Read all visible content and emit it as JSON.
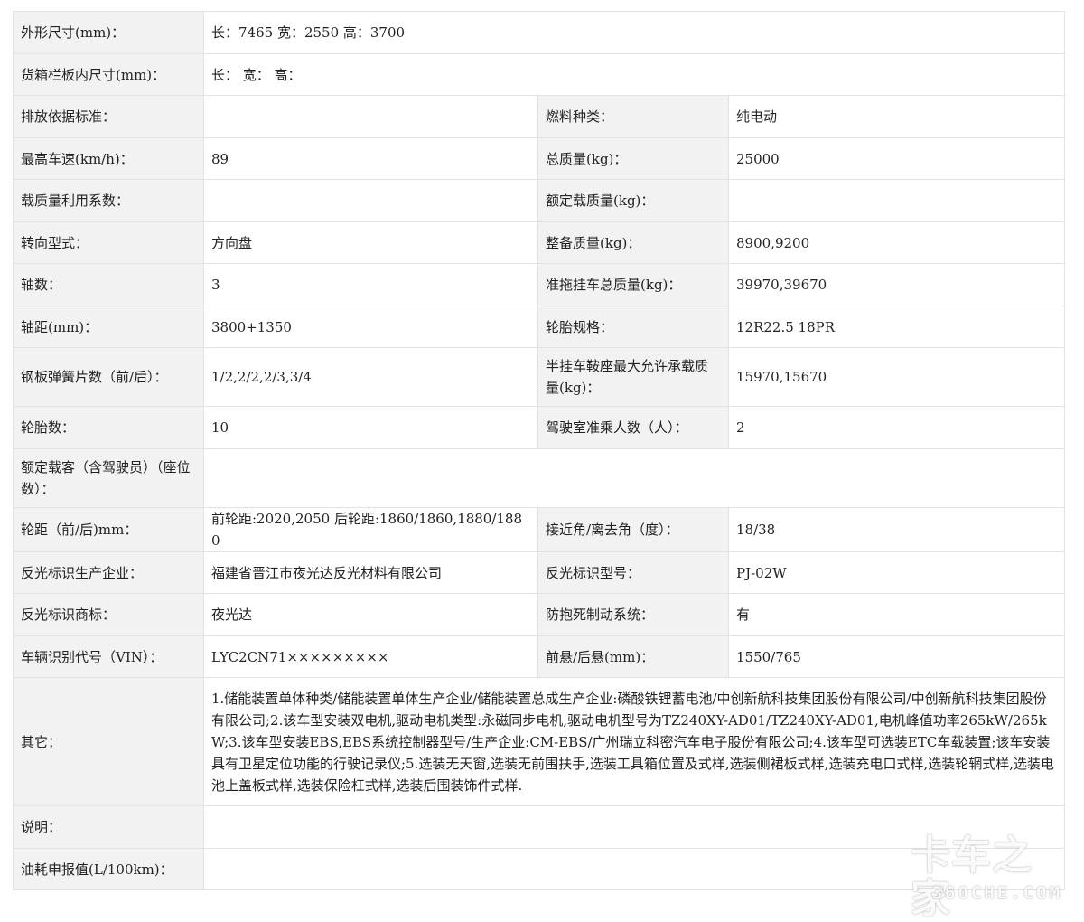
{
  "rows": {
    "dimensions": {
      "label": "外形尺寸(mm)：",
      "value": "长：7465 宽：2550 高：3700"
    },
    "cargo_box": {
      "label": "货箱栏板内尺寸(mm)：",
      "value": "长： 宽： 高："
    },
    "emission": {
      "label": "排放依据标准：",
      "value": "",
      "label2": "燃料种类：",
      "value2": "纯电动"
    },
    "max_speed": {
      "label": "最高车速(km/h)：",
      "value": "89",
      "label2": "总质量(kg)：",
      "value2": "25000"
    },
    "load_util": {
      "label": "载质量利用系数：",
      "value": "",
      "label2": "额定载质量(kg)：",
      "value2": ""
    },
    "steering": {
      "label": "转向型式：",
      "value": "方向盘",
      "label2": "整备质量(kg)：",
      "value2": "8900,9200"
    },
    "axles": {
      "label": "轴数：",
      "value": "3",
      "label2": "准拖挂车总质量(kg)：",
      "value2": "39970,39670"
    },
    "wheelbase": {
      "label": "轴距(mm)：",
      "value": "3800+1350",
      "label2": "轮胎规格：",
      "value2": "12R22.5 18PR"
    },
    "springs": {
      "label": "钢板弹簧片数（前/后）：",
      "value": "1/2,2/2,2/3,3/4",
      "label2": "半挂车鞍座最大允许承载质量(kg)：",
      "value2": "15970,15670"
    },
    "tires": {
      "label": "轮胎数：",
      "value": "10",
      "label2": "驾驶室准乘人数（人）：",
      "value2": "2"
    },
    "passengers": {
      "label": "额定载客（含驾驶员）（座位数）：",
      "value": ""
    },
    "track": {
      "label": "轮距（前/后)mm：",
      "value": "前轮距:2020,2050 后轮距:1860/1860,1880/1880",
      "label2": "接近角/离去角（度）：",
      "value2": "18/38"
    },
    "reflector_maker": {
      "label": "反光标识生产企业：",
      "value": "福建省晋江市夜光达反光材料有限公司",
      "label2": "反光标识型号：",
      "value2": "PJ-02W"
    },
    "reflector_brand": {
      "label": "反光标识商标：",
      "value": "夜光达",
      "label2": "防抱死制动系统：",
      "value2": "有"
    },
    "vin": {
      "label": "车辆识别代号（VIN）：",
      "value": "LYC2CN71×××××××××",
      "label2": "前悬/后悬(mm)：",
      "value2": "1550/765"
    },
    "other": {
      "label": "其它：",
      "value": "1.储能装置单体种类/储能装置单体生产企业/储能装置总成生产企业:磷酸铁锂蓄电池/中创新航科技集团股份有限公司/中创新航科技集团股份有限公司;2.该车型安装双电机,驱动电机类型:永磁同步电机,驱动电机型号为TZ240XY-AD01/TZ240XY-AD01,电机峰值功率265kW/265kW;3.该车型安装EBS,EBS系统控制器型号/生产企业:CM-EBS/广州瑞立科密汽车电子股份有限公司;4.该车型可选装ETC车载装置;该车安装具有卫星定位功能的行驶记录仪;5.选装无天窗,选装无前围扶手,选装工具箱位置及式样,选装侧裙板式样,选装充电口式样,选装轮辋式样,选装电池上盖板式样,选装保险杠式样,选装后围装饰件式样."
    },
    "description": {
      "label": "说明：",
      "value": ""
    },
    "fuel_consumption": {
      "label": "油耗申报值(L/100km)：",
      "value": ""
    }
  },
  "watermark": {
    "brand": "卡车之家",
    "domain": "360CHE.COM"
  },
  "colors": {
    "label_bg": "#f2f2f2",
    "border": "#e3e3e3",
    "text": "#222222"
  }
}
